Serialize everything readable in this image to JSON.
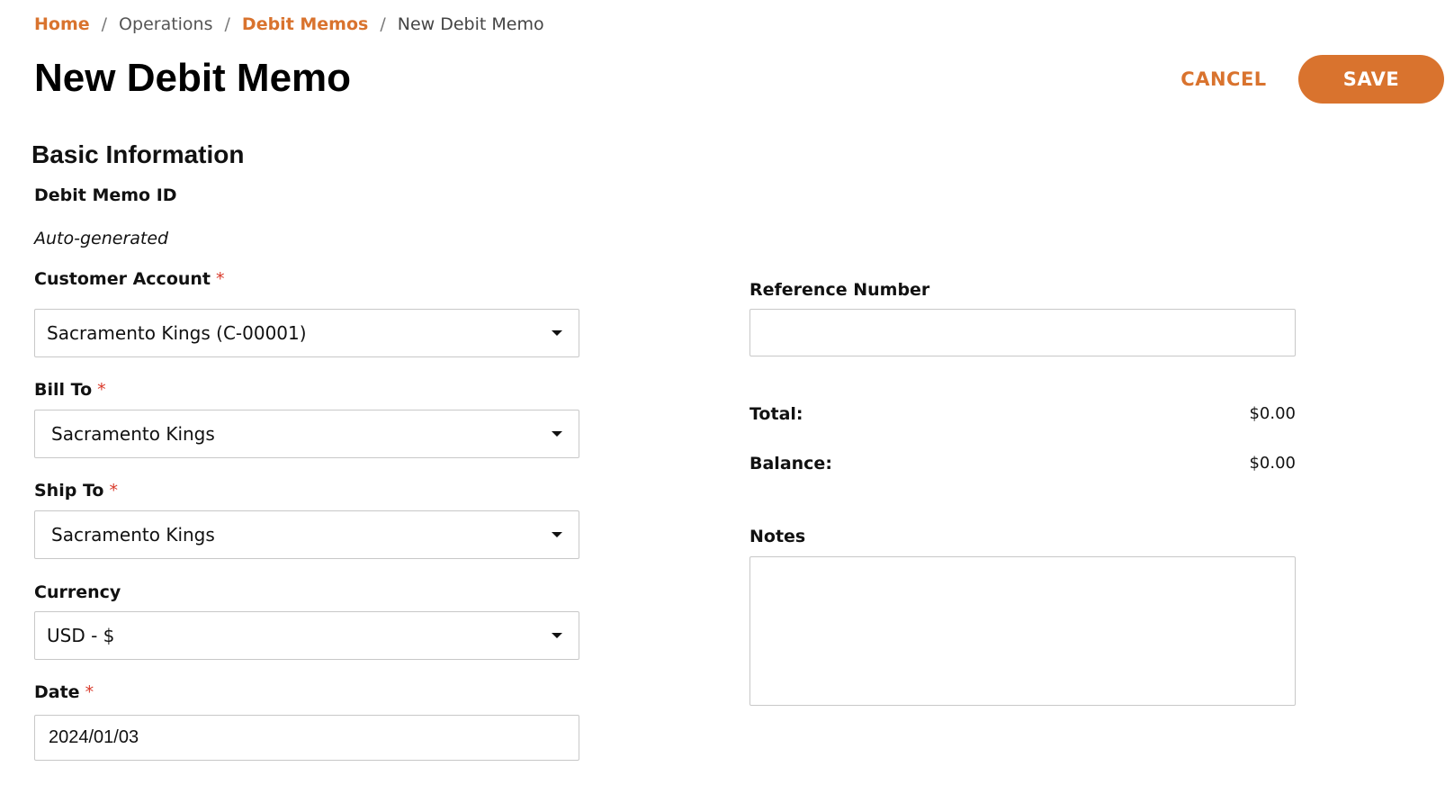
{
  "breadcrumb": {
    "home": "Home",
    "operations": "Operations",
    "debit_memos": "Debit Memos",
    "current": "New Debit Memo",
    "separator": "/"
  },
  "header": {
    "title": "New Debit Memo",
    "cancel_label": "CANCEL",
    "save_label": "SAVE"
  },
  "section": {
    "title": "Basic Information"
  },
  "form": {
    "debit_memo_id": {
      "label": "Debit Memo ID",
      "value": "Auto-generated"
    },
    "customer_account": {
      "label": "Customer Account",
      "required_mark": "*",
      "value": "Sacramento Kings (C-00001)"
    },
    "bill_to": {
      "label": "Bill To",
      "required_mark": "*",
      "value": "Sacramento Kings"
    },
    "ship_to": {
      "label": "Ship To",
      "required_mark": "*",
      "value": "Sacramento Kings"
    },
    "currency": {
      "label": "Currency",
      "value": "USD - $"
    },
    "date": {
      "label": "Date",
      "required_mark": "*",
      "value": "2024/01/03"
    },
    "reference_number": {
      "label": "Reference Number",
      "value": ""
    },
    "notes": {
      "label": "Notes",
      "value": ""
    }
  },
  "summary": {
    "total_label": "Total:",
    "total_value": "$0.00",
    "balance_label": "Balance:",
    "balance_value": "$0.00"
  },
  "colors": {
    "accent": "#d9732e",
    "required": "#d93a2b",
    "border": "#c8c8c8"
  },
  "icons": {
    "select_caret": "chevron-down-icon"
  }
}
